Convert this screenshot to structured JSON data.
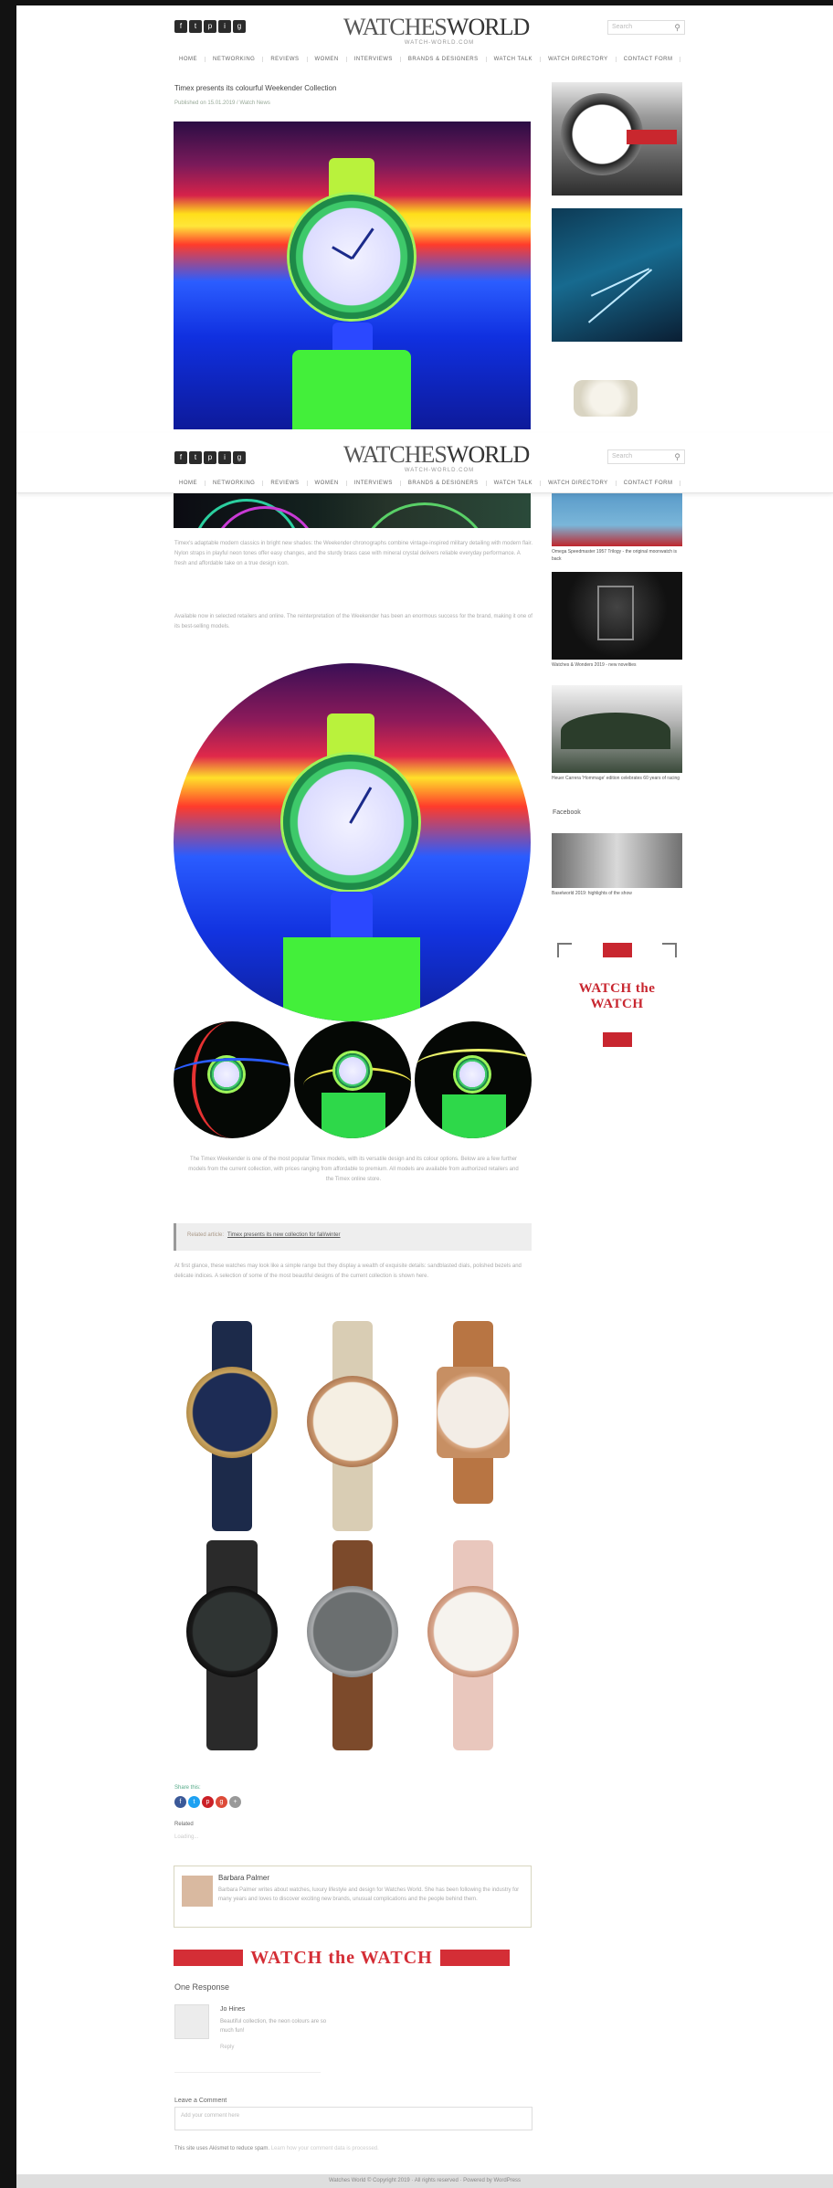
{
  "header": {
    "logo_main": "WATCHES",
    "logo_second": "WORLD",
    "logo_tag": "WATCH-WORLD.COM",
    "search_placeholder": "Search",
    "socials": [
      "f",
      "t",
      "p",
      "i",
      "g"
    ],
    "nav": [
      "HOME",
      "NETWORKING",
      "REVIEWS",
      "WOMEN",
      "INTERVIEWS",
      "BRANDS & DESIGNERS",
      "WATCH TALK",
      "WATCH DIRECTORY",
      "CONTACT FORM"
    ]
  },
  "article": {
    "title": "Timex presents its colourful Weekender Collection",
    "meta": "Published on 15.01.2019 / Watch News",
    "para1": "Timex's adaptable modern classics in bright new shades: the Weekender chronographs combine vintage-inspired military detailing with modern flair. Nylon straps in playful neon tones offer easy changes, and the sturdy brass case with mineral crystal delivers reliable everyday performance. A fresh and affordable take on a true design icon.",
    "para2": "Available now in selected retailers and online. The reinterpretation of the Weekender has been an enormous success for the brand, making it one of its best-selling models.",
    "caption": "The Timex Weekender is one of the most popular Timex models, with its versatile design and its colour options. Below are a few further models from the current collection, with prices ranging from affordable to premium. All models are available from authorized retailers and the Timex online store.",
    "quote_prefix": "Related article:",
    "quote_link": "Timex presents its new collection for fall/winter",
    "para3": "At first glance, these watches may look like a simple range but they display a wealth of exquisite details: sandblasted dials, polished bezels and delicate indices. A selection of some of the most beautiful designs of the current collection is shown here.",
    "tags_label": "Share this:",
    "share": [
      "f",
      "t",
      "p",
      "g",
      "+"
    ],
    "like_label": "Related",
    "like_sub": "Loading...",
    "author_name": "Barbara Palmer",
    "author_bio": "Barbara Palmer writes about watches, luxury lifestyle and design for Watches World. She has been following the industry for many years and loves to discover exciting new brands, unusual complications and the people behind them.",
    "banner_text": "WATCH the WATCH",
    "responses_title": "One Response",
    "comment_name": "Jo Hines",
    "comment_text": "Beautiful collection, the neon colours are so much fun!",
    "comment_reply": "Reply",
    "leave_label": "Leave a Comment",
    "comment_placeholder": "Add your comment here",
    "note_text": "This site uses Akismet to reduce spam.",
    "note_link": "Learn how your comment data is processed.",
    "footer": "Watches World © Copyright 2019 · All rights reserved · Powered by WordPress"
  },
  "sidebar": {
    "cap1": "Omega Speedmaster 1957 Trilogy - the original moonwatch is back",
    "cap2": "Watches & Wonders 2019 - new novelties",
    "cap3": "Heuer Carrera 'Hommage' edition celebrates 60 years of racing",
    "cap4": "Baselworld 2019: highlights of the show",
    "facebook_title": "Facebook",
    "wtw": "WATCH the WATCH"
  }
}
